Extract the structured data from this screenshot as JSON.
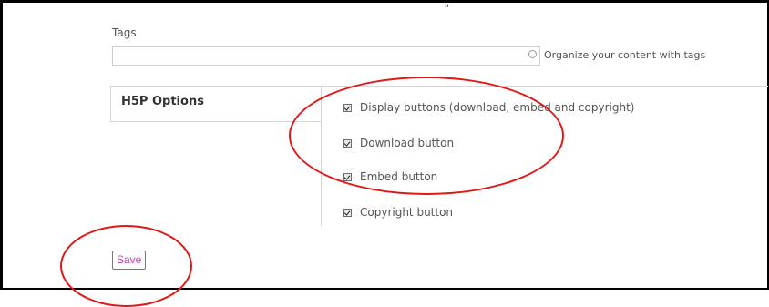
{
  "header": {
    "top_fragment": "„"
  },
  "tags": {
    "label": "Tags",
    "value": "",
    "help_text": "Organize your content with tags"
  },
  "h5p_options": {
    "title": "H5P Options",
    "options": [
      {
        "label": "Display buttons (download, embed and copyright)",
        "checked": true
      },
      {
        "label": "Download button",
        "checked": true
      },
      {
        "label": "Embed button",
        "checked": true
      },
      {
        "label": "Copyright button",
        "checked": true
      }
    ]
  },
  "actions": {
    "save_label": "Save"
  },
  "colors": {
    "save_accent": "#d838c8",
    "annotation_red": "#e01818"
  },
  "icons": {
    "help": "help-circle-icon",
    "checkbox": "checkbox-checked-icon"
  }
}
